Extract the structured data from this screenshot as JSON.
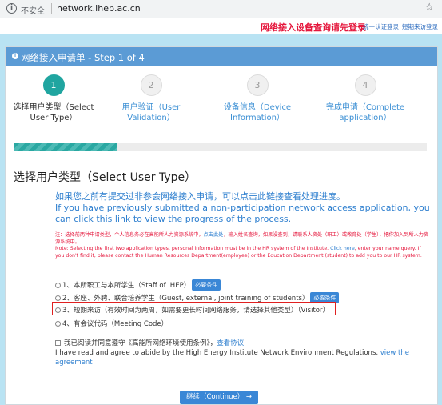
{
  "browser": {
    "insecure_label": "不安全",
    "url": "network.ihep.ac.cn",
    "info_icon": "i",
    "star_icon": "☆"
  },
  "topbar": {
    "login_prompt": "网络接入设备查询请先登录",
    "unified_login": "统一认证登录",
    "sms_login": "短期来访登录"
  },
  "form": {
    "title": "网络接入申请单 - Step 1 of 4",
    "steps": [
      {
        "number": "1",
        "label": "选择用户类型（Select User Type）"
      },
      {
        "number": "2",
        "label": "用户验证（User Validation）"
      },
      {
        "number": "3",
        "label": "设备信息（Device Information）"
      },
      {
        "number": "4",
        "label": "完成申请（Complete application）"
      }
    ],
    "progress": 0.25,
    "section_title": "选择用户类型（Select User Type）",
    "link_zh": "如果您之前有提交过非参会网络接入申请，可以点击此链接查看处理进度。",
    "link_en": "If you have previously submitted a non-participation network access application, you can click this link to view the progress of the process.",
    "note_zh_a": "注：选择前两种申请类型，个人信息务必在高能所人力资源系统中，",
    "note_zh_link": "点击此处",
    "note_zh_b": "，输入姓名查询，如果没查到，请联系人资处（职工）或教育处（学生），把你加入到所人力资源系统中。",
    "note_en_a": "Note: Selecting the first two application types, personal information must be in the HR system of the Institute.",
    "note_en_link": "Click here",
    "note_en_b": ", enter your name query. If you don't find it, please contact the Human Resources Department(employee) or the Education Department (student) to add you to our HR system.",
    "options": [
      {
        "label": "1、本所职工与本所学生（Staff of IHEP）",
        "badge": "必要条件"
      },
      {
        "label": "2、客座、外聘、联合培养学生（Guest, external, joint training of students）",
        "badge": "必要条件"
      },
      {
        "label": "3、短期来访（有效时间为两周，如需要更长时间网络服务，请选择其他类型）（Visitor）",
        "badge": ""
      },
      {
        "label": "4、有会议代码（Meeting Code）",
        "badge": ""
      }
    ],
    "agree_zh": "我已阅读并同意遵守《高能所网络环境使用条例》，",
    "agree_zh_link": "查看协议",
    "agree_en": "I have read and agree to abide by the High Energy Institute Network Environment Regulations,",
    "agree_en_link": "view the agreement",
    "continue_label": "继续（Continue）",
    "continue_icon": "→"
  },
  "colors": {
    "header_blue": "#5b9bd5",
    "accent_teal": "#20a5a0",
    "link_blue": "#2e7fcf",
    "alert_red": "#e5173c",
    "page_bg": "#b9e3f3"
  }
}
